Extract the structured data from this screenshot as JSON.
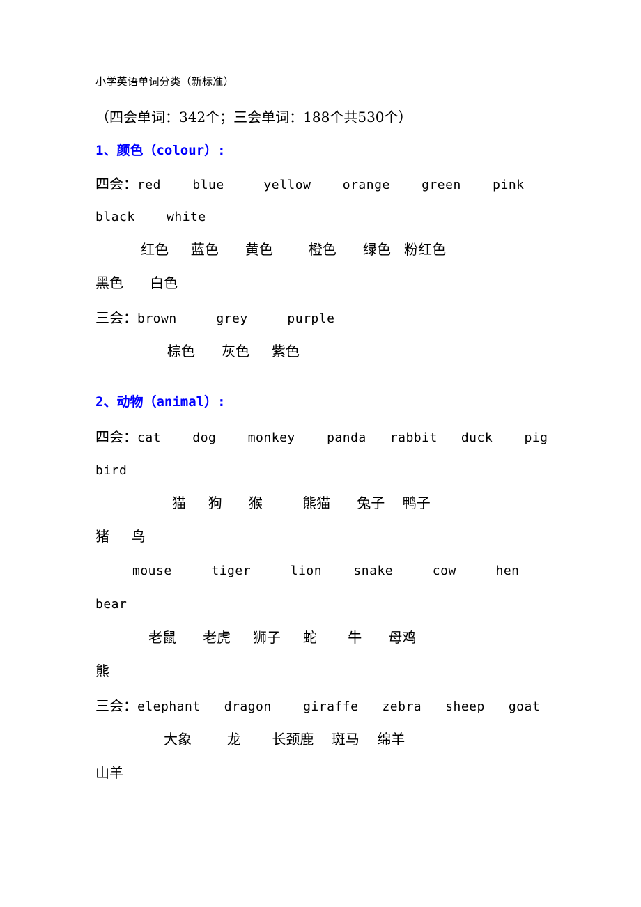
{
  "document": {
    "title": "小学英语单词分类（新标准）",
    "subtitle": "（四会单词：342个；三会单词：188个共530个）"
  },
  "labels": {
    "four_skills": "四会：",
    "three_skills": "三会："
  },
  "sections": [
    {
      "heading": "1、颜色（colour）:",
      "number": "1",
      "name_cn": "颜色",
      "name_en": "colour",
      "groups": [
        {
          "level": "四会",
          "english_lines": [
            "四会：red    blue    yellow    orange    green    pink",
            "black    white"
          ],
          "chinese_lines": [
            "        红色     蓝色     黄色        橙色     绿色   粉红色",
            "黑色     白色"
          ],
          "words": [
            {
              "en": "red",
              "cn": "红色"
            },
            {
              "en": "blue",
              "cn": "蓝色"
            },
            {
              "en": "yellow",
              "cn": "黄色"
            },
            {
              "en": "orange",
              "cn": "橙色"
            },
            {
              "en": "green",
              "cn": "绿色"
            },
            {
              "en": "pink",
              "cn": "粉红色"
            },
            {
              "en": "black",
              "cn": "黑色"
            },
            {
              "en": "white",
              "cn": "白色"
            }
          ]
        },
        {
          "level": "三会",
          "english_lines": [
            "三会：brown    grey    purple"
          ],
          "chinese_lines": [
            "       棕色    灰色    紫色"
          ],
          "words": [
            {
              "en": "brown",
              "cn": "棕色"
            },
            {
              "en": "grey",
              "cn": "灰色"
            },
            {
              "en": "purple",
              "cn": "紫色"
            }
          ]
        }
      ]
    },
    {
      "heading": "2、动物（animal）:",
      "number": "2",
      "name_cn": "动物",
      "name_en": "animal",
      "groups": [
        {
          "level": "四会",
          "english_lines": [
            "四会：cat    dog    monkey    panda   rabbit   duck    pig",
            "bird",
            "     mouse    tiger    lion    snake    cow    hen",
            "bear"
          ],
          "chinese_lines": [
            "          猫    狗     猴        熊猫     兔子    鸭子",
            "猪    鸟",
            "        老鼠     老虎    狮子    蛇      牛     母鸡",
            "熊"
          ],
          "words": [
            {
              "en": "cat",
              "cn": "猫"
            },
            {
              "en": "dog",
              "cn": "狗"
            },
            {
              "en": "monkey",
              "cn": "猴"
            },
            {
              "en": "panda",
              "cn": "熊猫"
            },
            {
              "en": "rabbit",
              "cn": "兔子"
            },
            {
              "en": "duck",
              "cn": "鸭子"
            },
            {
              "en": "pig",
              "cn": "猪"
            },
            {
              "en": "bird",
              "cn": "鸟"
            },
            {
              "en": "mouse",
              "cn": "老鼠"
            },
            {
              "en": "tiger",
              "cn": "老虎"
            },
            {
              "en": "lion",
              "cn": "狮子"
            },
            {
              "en": "snake",
              "cn": "蛇"
            },
            {
              "en": "cow",
              "cn": "牛"
            },
            {
              "en": "hen",
              "cn": "母鸡"
            },
            {
              "en": "bear",
              "cn": "熊"
            }
          ]
        },
        {
          "level": "三会",
          "english_lines": [
            "三会：elephant  dragon   giraffe  zebra   sheep   goat"
          ],
          "chinese_lines": [
            "        大象       龙      长颈鹿    斑马    绵羊",
            "山羊"
          ],
          "words": [
            {
              "en": "elephant",
              "cn": "大象"
            },
            {
              "en": "dragon",
              "cn": "龙"
            },
            {
              "en": "giraffe",
              "cn": "长颈鹿"
            },
            {
              "en": "zebra",
              "cn": "斑马"
            },
            {
              "en": "sheep",
              "cn": "绵羊"
            },
            {
              "en": "goat",
              "cn": "山羊"
            }
          ]
        }
      ]
    }
  ],
  "lines": {
    "title": "小学英语单词分类（新标准）",
    "subtitle": "（四会单词：342个；三会单词：188个共530个）",
    "s1_heading": "1、颜色（colour）:",
    "s1_g1_en1_label": "四会：",
    "s1_g1_en1_words": "red    blue     yellow    orange    green    pink",
    "s1_g1_en2": "black    white",
    "s1_g1_cn1": "红色     蓝色      黄色        橙色      绿色   粉红色",
    "s1_g1_cn2": "黑色      白色",
    "s1_g2_en_label": "三会：",
    "s1_g2_en_words": "brown     grey     purple",
    "s1_g2_cn": "棕色      灰色     紫色",
    "s2_heading": "2、动物（animal）:",
    "s2_g1_en1_label": "四会：",
    "s2_g1_en1_words": "cat    dog    monkey    panda   rabbit   duck    pig",
    "s2_g1_en2": "bird",
    "s2_g1_cn1": "猫     狗      猴         熊猫      兔子    鸭子",
    "s2_g1_cn2": "猪     鸟",
    "s2_g1_en3": "mouse     tiger     lion    snake     cow     hen",
    "s2_g1_en4": "bear",
    "s2_g1_cn3": "老鼠      老虎     狮子     蛇       牛      母鸡",
    "s2_g1_cn4": "熊",
    "s2_g2_en_label": "三会：",
    "s2_g2_en_words": "elephant   dragon    giraffe   zebra   sheep   goat",
    "s2_g2_cn1": "大象        龙       长颈鹿    斑马    绵羊",
    "s2_g2_cn2": "山羊"
  },
  "colors": {
    "heading": "#0000ff",
    "text": "#000000",
    "background": "#ffffff"
  }
}
